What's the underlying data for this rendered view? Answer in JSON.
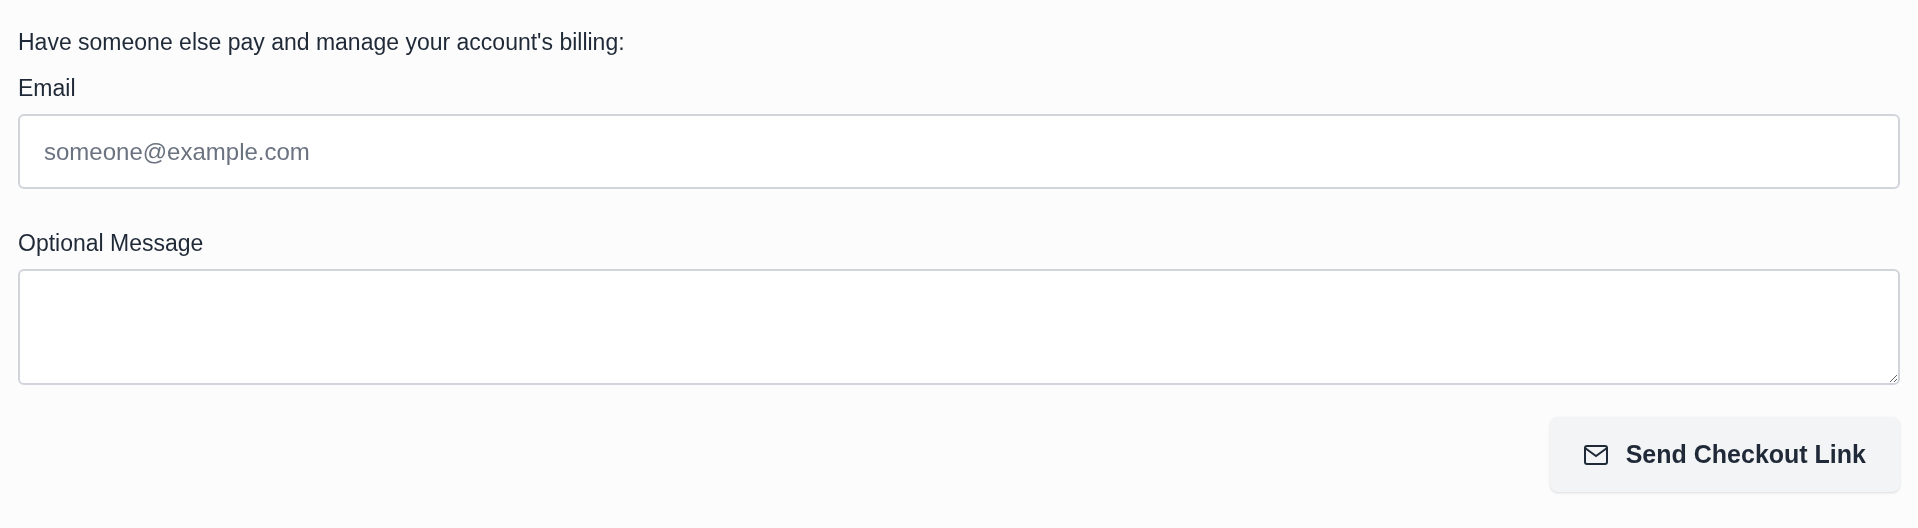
{
  "intro": "Have someone else pay and manage your account's billing:",
  "email": {
    "label": "Email",
    "placeholder": "someone@example.com"
  },
  "message": {
    "label": "Optional Message"
  },
  "button": {
    "label": "Send Checkout Link"
  }
}
